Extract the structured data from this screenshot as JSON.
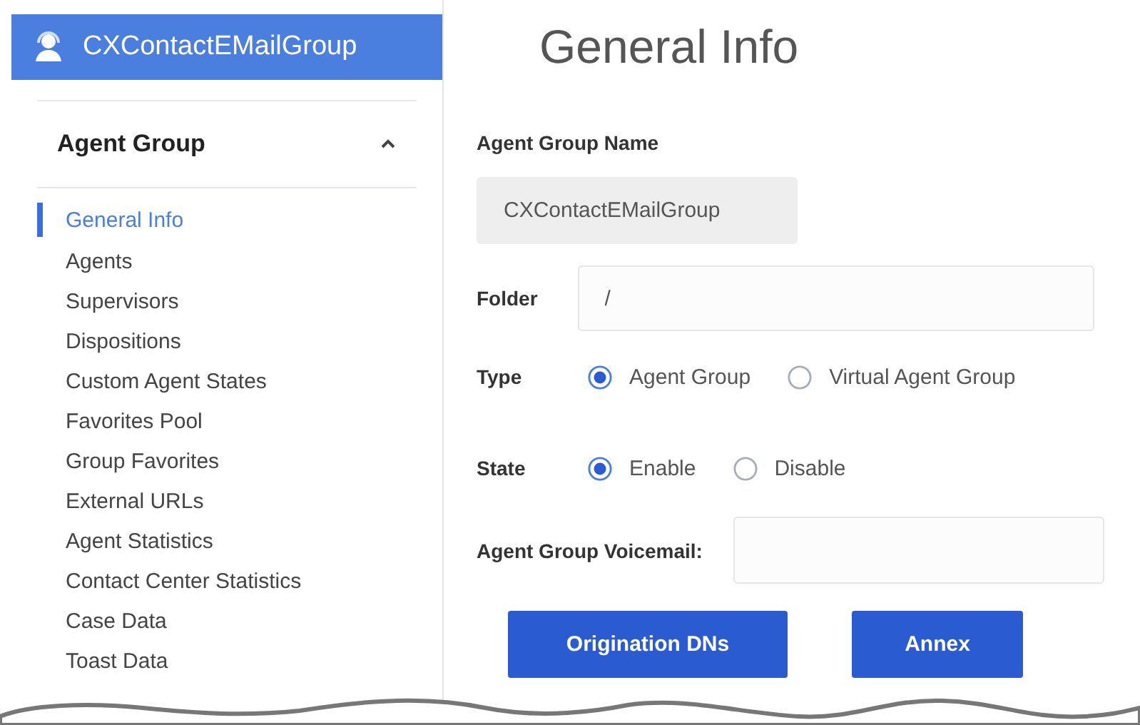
{
  "header": {
    "title": "CXContactEMailGroup"
  },
  "sidebar": {
    "section": {
      "title": "Agent Group",
      "expanded": true
    },
    "items": [
      {
        "label": "General Info",
        "selected": true
      },
      {
        "label": "Agents",
        "selected": false
      },
      {
        "label": "Supervisors",
        "selected": false
      },
      {
        "label": "Dispositions",
        "selected": false
      },
      {
        "label": "Custom Agent States",
        "selected": false
      },
      {
        "label": "Favorites Pool",
        "selected": false
      },
      {
        "label": "Group Favorites",
        "selected": false
      },
      {
        "label": "External URLs",
        "selected": false
      },
      {
        "label": "Agent Statistics",
        "selected": false
      },
      {
        "label": "Contact Center Statistics",
        "selected": false
      },
      {
        "label": "Case Data",
        "selected": false
      },
      {
        "label": "Toast Data",
        "selected": false
      }
    ]
  },
  "main": {
    "title": "General Info",
    "fields": [
      {
        "kind": "readonly",
        "label": "Agent Group Name",
        "value": "CXContactEMailGroup"
      },
      {
        "kind": "text",
        "label": "Folder",
        "value": "/"
      },
      {
        "kind": "radio",
        "label": "Type",
        "options": [
          {
            "label": "Agent Group",
            "selected": true
          },
          {
            "label": "Virtual Agent Group",
            "selected": false
          }
        ]
      },
      {
        "kind": "radio",
        "label": "State",
        "options": [
          {
            "label": "Enable",
            "selected": true
          },
          {
            "label": "Disable",
            "selected": false
          }
        ]
      },
      {
        "kind": "wide",
        "label": "Agent Group Voicemail:"
      }
    ],
    "buttons": [
      "Origination DNs",
      "Annex"
    ]
  }
}
